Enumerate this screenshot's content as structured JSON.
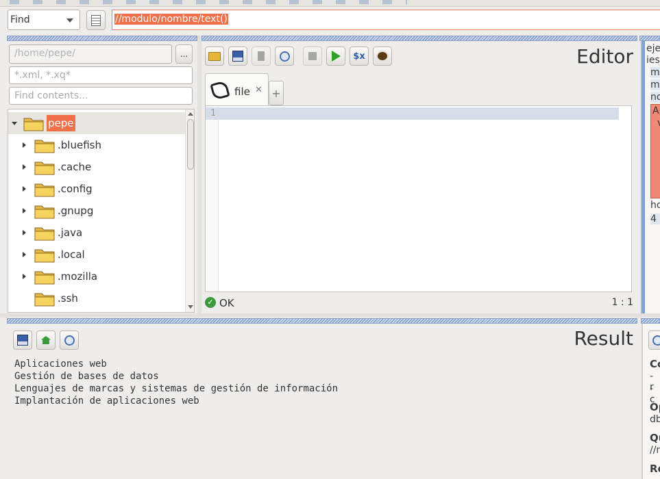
{
  "search": {
    "mode": "Find",
    "query": "//modulo/nombre/text()"
  },
  "files": {
    "path_placeholder": "/home/pepe/",
    "browse_label": "...",
    "filter_placeholder": "*.xml, *.xq*",
    "contents_placeholder": "Find contents...",
    "tree": [
      {
        "name": "pepe",
        "expanded": true,
        "selected": true
      },
      {
        "name": ".bluefish"
      },
      {
        "name": ".cache"
      },
      {
        "name": ".config"
      },
      {
        "name": ".gnupg"
      },
      {
        "name": ".java"
      },
      {
        "name": ".local"
      },
      {
        "name": ".mozilla"
      },
      {
        "name": ".ssh",
        "leaf": true
      }
    ]
  },
  "editor": {
    "title": "Editor",
    "tab_label": "file",
    "line_number": "1",
    "status": "OK",
    "position": "1 : 1"
  },
  "result": {
    "title": "Result",
    "lines": [
      "Aplicaciones web",
      "Gestión de bases de datos",
      "Lenguajes de marcas y sistemas de gestión de información",
      "Implantación de aplicaciones web"
    ]
  },
  "right_panel": {
    "fragments": [
      "eje",
      "ies",
      "mo",
      "m",
      "no",
      "Ap",
      "v",
      "ho",
      "4"
    ]
  },
  "info_panel": {
    "fragments": [
      "Co",
      "- r",
      "- c",
      "Op",
      "db",
      "Qu",
      "//n",
      "Re"
    ]
  },
  "colors": {
    "accent": "#f0704a",
    "selection": "#d5dde9",
    "hatch": "#6f8fbf"
  }
}
